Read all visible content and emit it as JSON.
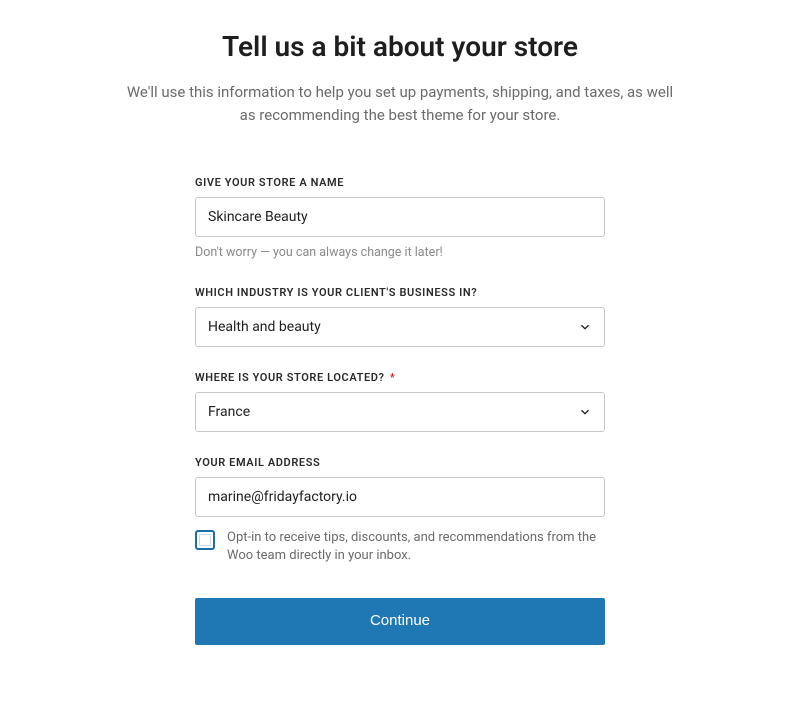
{
  "title": "Tell us a bit about your store",
  "subtitle": "We'll use this information to help you set up payments, shipping, and taxes, as well as recommending the best theme for your store.",
  "fields": {
    "store_name": {
      "label": "GIVE YOUR STORE A NAME",
      "value": "Skincare Beauty",
      "helper": "Don't worry — you can always change it later!"
    },
    "industry": {
      "label": "WHICH INDUSTRY IS YOUR CLIENT'S BUSINESS IN?",
      "value": "Health and beauty"
    },
    "location": {
      "label": "WHERE IS YOUR STORE LOCATED?",
      "required_marker": "*",
      "value": "France"
    },
    "email": {
      "label": "YOUR EMAIL ADDRESS",
      "value": "marine@fridayfactory.io"
    },
    "optin": {
      "label": "Opt-in to receive tips, discounts, and recommendations from the Woo team directly in your inbox.",
      "checked": false
    }
  },
  "continue_label": "Continue"
}
